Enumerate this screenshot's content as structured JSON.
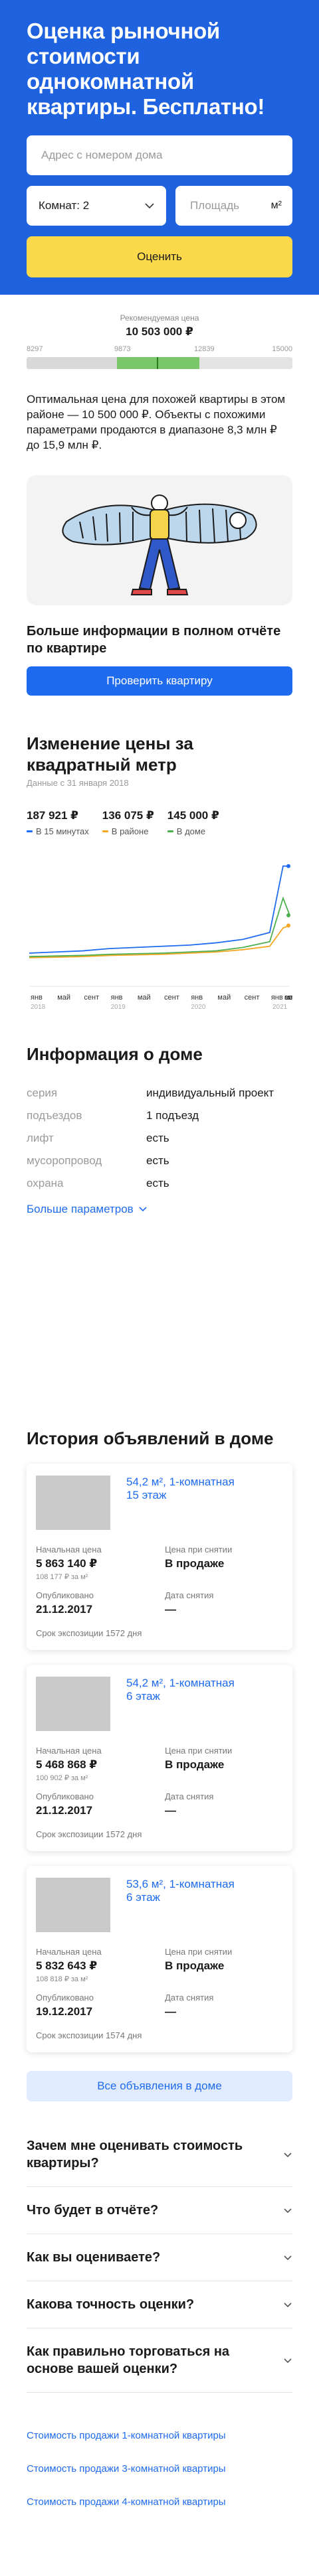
{
  "hero": {
    "title": "Оценка рыночной стоимости однокомнатной квартиры. Бесплатно!",
    "address_placeholder": "Адрес с номером дома",
    "rooms_value": "Комнат: 2",
    "area_placeholder": "Площадь",
    "area_unit": "м²",
    "submit_label": "Оценить"
  },
  "scale": {
    "rec_label": "Рекомендуемая цена",
    "rec_value": "10 503 000 ₽",
    "ticks": [
      "8297",
      "9873",
      "12839",
      "15000"
    ],
    "description": "Оптимальная цена для похожей квартиры в этом районе — 10 500 000 ₽. Объекты с похожими параметрами продаются в диапазоне 8,3 млн ₽ до 15,9 млн ₽."
  },
  "promo": {
    "title": "Больше информации в полном отчёте по квартире",
    "button_label": "Проверить квартиру"
  },
  "price_chart": {
    "title": "Изменение цены за квадратный метр",
    "subtitle": "Данные с 31 января 2018",
    "colors": {
      "walk": "#1f6bf0",
      "district": "#f5a623",
      "house": "#4caf50"
    },
    "legend": [
      {
        "value": "187 921 ₽",
        "label": "В 15 минутах",
        "color": "#1f6bf0"
      },
      {
        "value": "136 075 ₽",
        "label": "В районе",
        "color": "#f5a623"
      },
      {
        "value": "145 000 ₽",
        "label": "В доме",
        "color": "#4caf50"
      }
    ],
    "month_labels": [
      "янв",
      "май",
      "сент",
      "янв",
      "май",
      "сент",
      "янв",
      "май",
      "сент",
      "янв",
      "май",
      "сент",
      "апр"
    ],
    "year_labels": [
      "2018",
      "2019",
      "2020",
      "2021"
    ]
  },
  "chart_data": {
    "type": "line",
    "x": [
      "2018-01",
      "2018-05",
      "2018-09",
      "2019-01",
      "2019-05",
      "2019-09",
      "2020-01",
      "2020-05",
      "2020-09",
      "2021-01",
      "2021-03",
      "2021-04"
    ],
    "series": [
      {
        "name": "В 15 минутах",
        "values": [
          112000,
          113000,
          114000,
          116000,
          117000,
          118000,
          119000,
          121000,
          124000,
          130000,
          188000,
          187921
        ]
      },
      {
        "name": "В районе",
        "values": [
          108000,
          108500,
          109000,
          110000,
          110500,
          111000,
          112000,
          113000,
          115000,
          118000,
          134000,
          136075
        ]
      },
      {
        "name": "В доме",
        "values": [
          109000,
          109500,
          110000,
          111000,
          111500,
          112000,
          113000,
          114000,
          117000,
          122000,
          160000,
          145000
        ]
      }
    ],
    "ylim": [
      90000,
      200000
    ],
    "grid": false
  },
  "house": {
    "title": "Информация о доме",
    "rows": [
      {
        "k": "серия",
        "v": "индивидуальный проект"
      },
      {
        "k": "подъездов",
        "v": "1 подъезд"
      },
      {
        "k": "лифт",
        "v": "есть"
      },
      {
        "k": "мусоропровод",
        "v": "есть"
      },
      {
        "k": "охрана",
        "v": "есть"
      }
    ],
    "more_label": "Больше параметров"
  },
  "listings": {
    "title": "История объявлений в доме",
    "labels": {
      "start_price": "Начальная цена",
      "removed_price": "Цена при снятии",
      "published": "Опубликовано",
      "removed_date": "Дата снятия"
    },
    "items": [
      {
        "title": "54,2 м², 1-комнатная",
        "floor": "15 этаж",
        "start_price": "5 863 140 ₽",
        "per_m": "108 177 ₽ за м²",
        "removed_price": "В продаже",
        "published": "21.12.2017",
        "removed_date": "—",
        "exposure": "Срок экспозиции 1572 дня"
      },
      {
        "title": "54,2 м², 1-комнатная",
        "floor": "6 этаж",
        "start_price": "5 468 868 ₽",
        "per_m": "100 902 ₽ за м²",
        "removed_price": "В продаже",
        "published": "21.12.2017",
        "removed_date": "—",
        "exposure": "Срок экспозиции 1572 дня"
      },
      {
        "title": "53,6 м², 1-комнатная",
        "floor": "6 этаж",
        "start_price": "5 832 643 ₽",
        "per_m": "108 818 ₽ за м²",
        "removed_price": "В продаже",
        "published": "19.12.2017",
        "removed_date": "—",
        "exposure": "Срок экспозиции 1574 дня"
      }
    ],
    "all_label": "Все объявления в доме"
  },
  "faq": [
    "Зачем мне оценивать стоимость квартиры?",
    "Что будет в отчёте?",
    "Как вы оцениваете?",
    "Какова точность оценки?",
    "Как правильно торговаться на основе вашей оценки?"
  ],
  "links": [
    "Стоимость продажи 1-комнатной квартиры",
    "Стоимость продажи 3-комнатной квартиры",
    "Стоимость продажи 4-комнатной квартиры"
  ]
}
